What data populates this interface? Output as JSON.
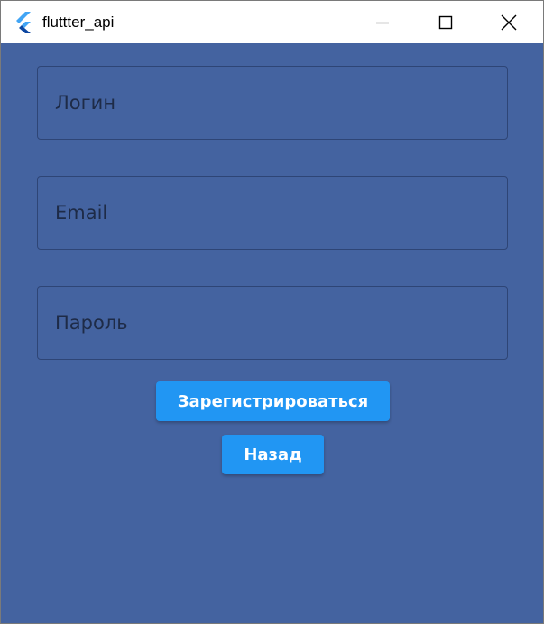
{
  "window": {
    "title": "fluttter_api",
    "icon": "flutter-logo-icon",
    "controls": [
      "minimize-icon",
      "maximize-icon",
      "close-icon"
    ]
  },
  "form": {
    "login": {
      "value": "",
      "placeholder": "Логин"
    },
    "email": {
      "value": "",
      "placeholder": "Email"
    },
    "password": {
      "value": "",
      "placeholder": "Пароль"
    }
  },
  "buttons": {
    "register_label": "Зарегистрироваться",
    "back_label": "Назад"
  },
  "colors": {
    "background": "#4463a0",
    "button": "#2196f3",
    "field_border": "#2e4576",
    "placeholder": "#1e2b47"
  }
}
